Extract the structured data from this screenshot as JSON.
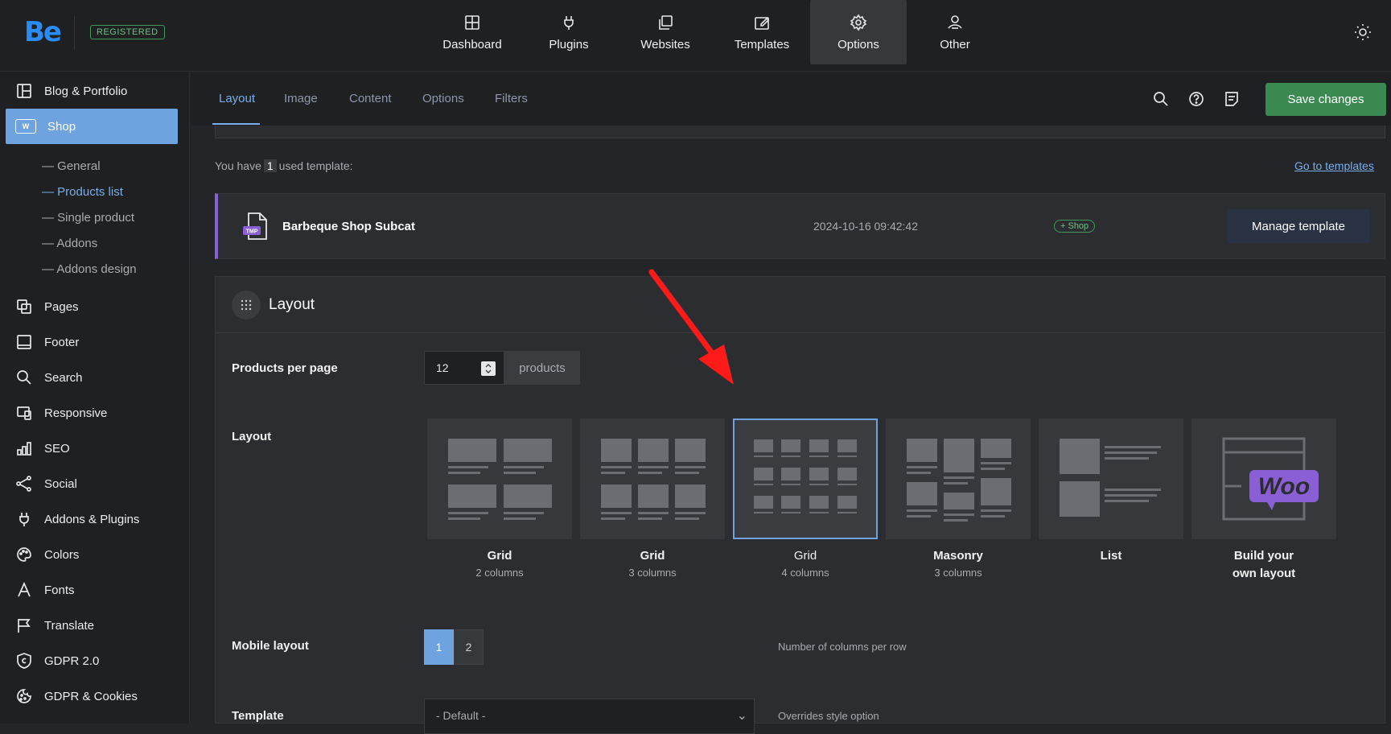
{
  "app": {
    "logo": "Be",
    "badge": "REGISTERED"
  },
  "topnav": [
    {
      "label": "Dashboard",
      "icon": "dashboard-icon"
    },
    {
      "label": "Plugins",
      "icon": "plug-icon"
    },
    {
      "label": "Websites",
      "icon": "websites-icon"
    },
    {
      "label": "Templates",
      "icon": "templates-icon"
    },
    {
      "label": "Options",
      "icon": "gear-icon",
      "active": true
    },
    {
      "label": "Other",
      "icon": "other-icon"
    }
  ],
  "sidebar": {
    "items": [
      {
        "label": "Blog & Portfolio",
        "icon": "blog-icon"
      },
      {
        "label": "Shop",
        "icon": "woo-icon",
        "active": true
      },
      {
        "label": "Pages",
        "icon": "pages-icon"
      },
      {
        "label": "Footer",
        "icon": "footer-icon"
      },
      {
        "label": "Search",
        "icon": "search-icon"
      },
      {
        "label": "Responsive",
        "icon": "responsive-icon"
      },
      {
        "label": "SEO",
        "icon": "seo-icon"
      },
      {
        "label": "Social",
        "icon": "share-icon"
      },
      {
        "label": "Addons & Plugins",
        "icon": "plug-icon"
      },
      {
        "label": "Colors",
        "icon": "palette-icon"
      },
      {
        "label": "Fonts",
        "icon": "font-icon"
      },
      {
        "label": "Translate",
        "icon": "flag-icon"
      },
      {
        "label": "GDPR 2.0",
        "icon": "shield-icon"
      },
      {
        "label": "GDPR & Cookies",
        "icon": "cookie-icon"
      }
    ],
    "shop_sub": [
      {
        "label": "General"
      },
      {
        "label": "Products list",
        "active": true
      },
      {
        "label": "Single product"
      },
      {
        "label": "Addons"
      },
      {
        "label": "Addons design"
      }
    ]
  },
  "tabs": [
    "Layout",
    "Image",
    "Content",
    "Options",
    "Filters"
  ],
  "toolbar": {
    "save_label": "Save changes"
  },
  "templates": {
    "used_prefix": "You have",
    "used_count": "1",
    "used_suffix": "used template:",
    "goto_label": "Go to templates",
    "card": {
      "name": "Barbeque Shop Subcat",
      "date": "2024-10-16 09:42:42",
      "badge": "+ Shop",
      "icon_text": "TMP",
      "manage_label": "Manage template"
    }
  },
  "layout_panel": {
    "title": "Layout",
    "products_per_page": {
      "label": "Products per page",
      "value": "12",
      "suffix": "products"
    },
    "layout": {
      "label": "Layout",
      "options": [
        {
          "title": "Grid",
          "sub": "2 columns"
        },
        {
          "title": "Grid",
          "sub": "3 columns"
        },
        {
          "title": "Grid",
          "sub": "4 columns",
          "selected": true
        },
        {
          "title": "Masonry",
          "sub": "3 columns"
        },
        {
          "title": "List",
          "sub": ""
        },
        {
          "title": "Build your",
          "sub": "own layout"
        }
      ],
      "woo_text": "Woo"
    },
    "mobile_layout": {
      "label": "Mobile layout",
      "options": [
        "1",
        "2"
      ],
      "selected": "1",
      "hint": "Number of columns per row"
    },
    "template": {
      "label": "Template",
      "value": "- Default -",
      "hint": "Overrides style option"
    }
  },
  "colors": {
    "accent": "#79aee8",
    "save": "#3b8a52",
    "annotation_arrow": "#ff0000",
    "tmpl_border": "#8a5fd6"
  }
}
